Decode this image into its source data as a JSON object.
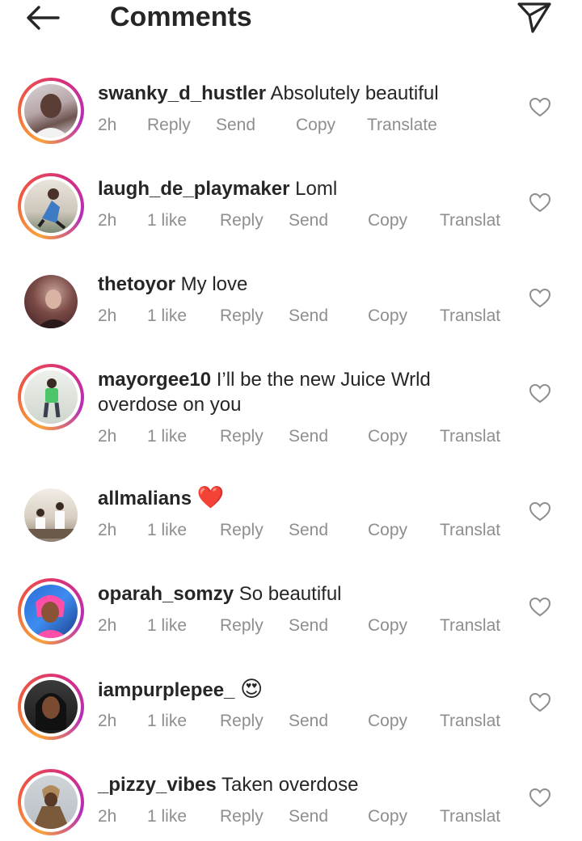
{
  "header": {
    "title": "Comments",
    "back_icon": "arrow-left-icon",
    "dm_icon": "paper-plane-icon"
  },
  "comments": [
    {
      "username": "swanky_d_hustler",
      "text": "Absolutely beautiful",
      "time": "2h",
      "likes": "",
      "reply": "Reply",
      "send": "Send",
      "copy": "Copy",
      "translate": "Translate",
      "has_ring": true
    },
    {
      "username": "laugh_de_playmaker",
      "text": "Loml",
      "time": "2h",
      "likes": "1 like",
      "reply": "Reply",
      "send": "Send",
      "copy": "Copy",
      "translate": "Translat",
      "has_ring": true
    },
    {
      "username": "thetoyor",
      "text": "My love",
      "time": "2h",
      "likes": "1 like",
      "reply": "Reply",
      "send": "Send",
      "copy": "Copy",
      "translate": "Translat",
      "has_ring": false
    },
    {
      "username": "mayorgee10",
      "text": "I’ll be the new Juice Wrld",
      "text2": "overdose on you",
      "time": "2h",
      "likes": "1 like",
      "reply": "Reply",
      "send": "Send",
      "copy": "Copy",
      "translate": "Translat",
      "has_ring": true
    },
    {
      "username": "allmalians",
      "text": "❤️",
      "time": "2h",
      "likes": "1 like",
      "reply": "Reply",
      "send": "Send",
      "copy": "Copy",
      "translate": "Translat",
      "has_ring": false
    },
    {
      "username": "oparah_somzy",
      "text": "So beautiful",
      "time": "2h",
      "likes": "1 like",
      "reply": "Reply",
      "send": "Send",
      "copy": "Copy",
      "translate": "Translat",
      "has_ring": true
    },
    {
      "username": "iampurplepee_",
      "text": "😍",
      "time": "2h",
      "likes": "1 like",
      "reply": "Reply",
      "send": "Send",
      "copy": "Copy",
      "translate": "Translat",
      "has_ring": true
    },
    {
      "username": "_pizzy_vibes",
      "text": "Taken overdose",
      "time": "2h",
      "likes": "1 like",
      "reply": "Reply",
      "send": "Send",
      "copy": "Copy",
      "translate": "Translat",
      "has_ring": true
    }
  ],
  "colors": {
    "text": "#262626",
    "secondary": "#8e8e8e",
    "ring_start": "#f9a33a",
    "ring_end": "#b52eb9"
  }
}
